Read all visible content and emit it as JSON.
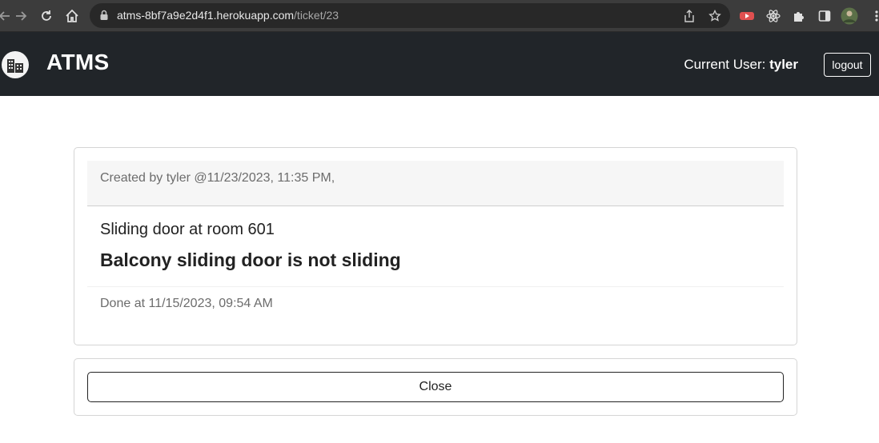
{
  "browser": {
    "url_host": "atms-8bf7a9e2d4f1.herokuapp.com",
    "url_path": "/ticket/23"
  },
  "navbar": {
    "brand": "ATMS",
    "user_prefix": "Current User: ",
    "username": "tyler",
    "logout_label": "logout"
  },
  "ticket": {
    "created_text": "Created by tyler @11/23/2023, 11:35 PM,",
    "title": "Sliding door at room 601",
    "description": "Balcony sliding door is not sliding",
    "done_text": "Done at 11/15/2023, 09:54 AM"
  },
  "actions": {
    "close_label": "Close"
  },
  "colors": {
    "navbar_bg": "#212529",
    "browser_bg": "#3c3c3c"
  }
}
